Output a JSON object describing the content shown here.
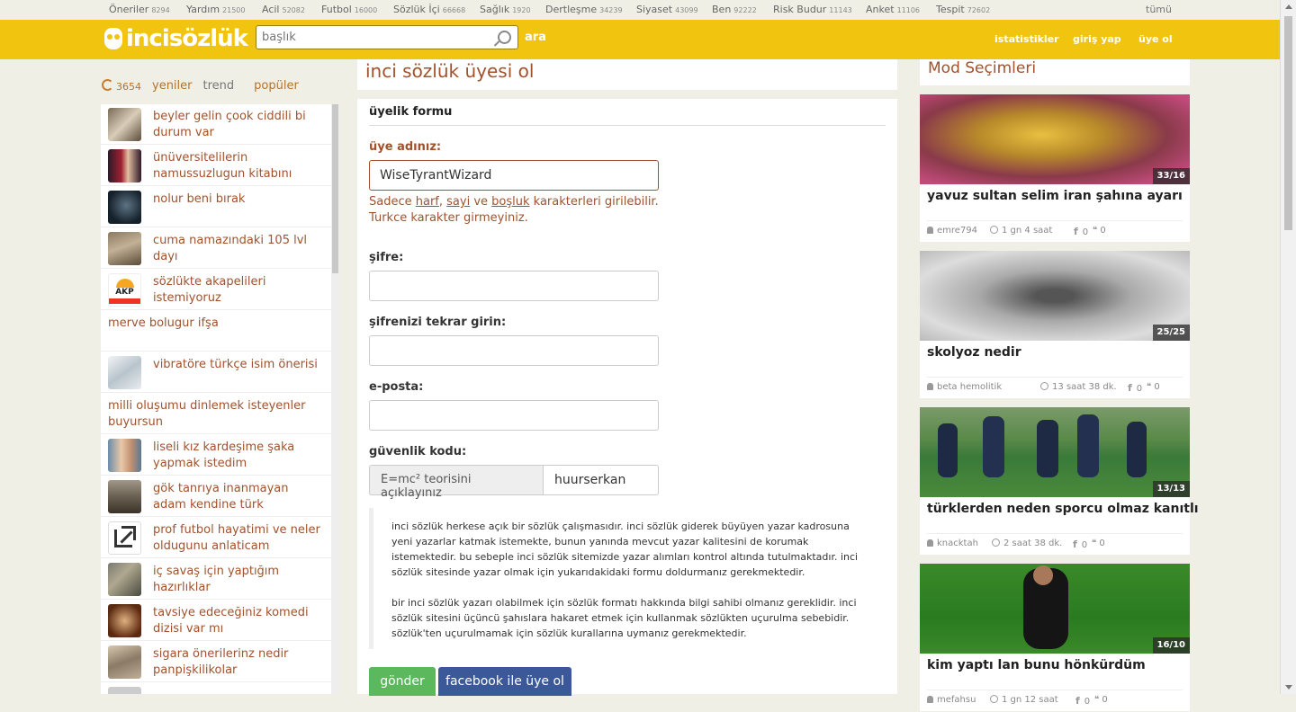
{
  "topnav": {
    "categories": [
      {
        "label": "Öneriler",
        "count": "8294"
      },
      {
        "label": "Yardım",
        "count": "21500"
      },
      {
        "label": "Acil",
        "count": "52082"
      },
      {
        "label": "Futbol",
        "count": "16000"
      },
      {
        "label": "Sözlük İçi",
        "count": "66668"
      },
      {
        "label": "Sağlık",
        "count": "1920"
      },
      {
        "label": "Dertleşme",
        "count": "34239"
      },
      {
        "label": "Siyaset",
        "count": "43099"
      },
      {
        "label": "Ben",
        "count": "92222"
      },
      {
        "label": "Risk Budur",
        "count": "11143"
      },
      {
        "label": "Anket",
        "count": "11106"
      },
      {
        "label": "Tespit",
        "count": "72602"
      }
    ],
    "all_label": "tümü"
  },
  "header": {
    "logo_text": "incisözlük",
    "search_placeholder": "başlık",
    "search_button": "ara",
    "links": [
      "istatistikler",
      "giriş yap",
      "üye ol"
    ],
    "accent": "#f1c40f"
  },
  "left": {
    "count": "3654",
    "tabs": [
      "yeniler",
      "trend",
      "popüler"
    ],
    "items": [
      {
        "text": "beyler gelin çook ciddili bi durum var",
        "thumb": true
      },
      {
        "text": "ünüversitelilerin namussuzlugun kitabını",
        "thumb": true
      },
      {
        "text": "nolur beni bırak",
        "thumb": true
      },
      {
        "text": "cuma namazındaki 105 lvl dayı",
        "thumb": true
      },
      {
        "text": "sözlükte akapelileri istemiyoruz",
        "thumb": true,
        "thumb_label": "AKP"
      },
      {
        "text": "merve bolugur ifşa",
        "thumb": false
      },
      {
        "text": "vibratöre türkçe isim önerisi",
        "thumb": true
      },
      {
        "text": "milli oluşumu dinlemek isteyenler buyursun",
        "thumb": false
      },
      {
        "text": "liseli kız kardeşime şaka yapmak istedim",
        "thumb": true
      },
      {
        "text": "gök tanrıya inanmayan adam kendine türk",
        "thumb": true
      },
      {
        "text": "prof futbol hayatimi ve neler oldugunu anlaticam",
        "thumb": true,
        "icon": "external-link-icon"
      },
      {
        "text": "iç savaş için yaptığım hazırlıklar",
        "thumb": true
      },
      {
        "text": "tavsiye edeceğiniz komedi dizisi var mı",
        "thumb": true
      },
      {
        "text": "sigara önerilerinz nedir panpişkilikolar",
        "thumb": true
      },
      {
        "text": "",
        "thumb": true
      }
    ]
  },
  "main": {
    "title": "inci sözlük üyesi ol",
    "form_header": "üyelik formu",
    "username_label": "üye adınız:",
    "username_value": "WiseTyrantWizard",
    "hint_pre": "Sadece ",
    "hint_w1": "harf",
    "hint_s1": ", ",
    "hint_w2": "sayi",
    "hint_s2": " ve ",
    "hint_w3": "boşluk",
    "hint_post": " karakterleri girilebilir.",
    "hint_line2": "Turkce karakter girmeyiniz.",
    "password_label": "şifre:",
    "password_repeat_label": "şifrenizi tekrar girin:",
    "email_label": "e-posta:",
    "captcha_label": "güvenlik kodu:",
    "captcha_question": "E=mc² teorisini açıklayınız",
    "captcha_answer": "huurserkan",
    "info_p1": "inci sözlük herkese açık bir sözlük çalışmasıdır. inci sözlük giderek büyüyen yazar kadrosuna yeni yazarlar katmak istemekte, bunun yanında mevcut yazar kalitesini de korumak istemektedir. bu sebeple inci sözlük sitemizde yazar alımları kontrol altında tutulmaktadır. inci sözlük sitesinde yazar olmak için yukarıdakidaki formu doldurmanız gerekmektedir.",
    "info_p2": "bir inci sözlük yazarı olabilmek için sözlük formatı hakkında bilgi sahibi olmanız gereklidir. inci sözlük sitesini üçüncü şahıslara hakaret etmek için kullanmak sözlükten uçurulma sebebidir. sözlük'ten uçurulmamak için sözlük kurallarına uymanız gerekmektedir.",
    "submit": "gönder",
    "facebook": "facebook ile üye ol"
  },
  "right": {
    "title": "Mod Seçimleri",
    "cards": [
      {
        "badge": "33/16",
        "title": "yavuz sultan selim iran şahına ayarı",
        "user": "emre794",
        "time": "1 gn 4 saat",
        "fb": "0",
        "tw": "0"
      },
      {
        "badge": "25/25",
        "title": "skolyoz nedir",
        "user": "beta hemolitik",
        "time": "13 saat 38 dk.",
        "fb": "0",
        "tw": "0"
      },
      {
        "badge": "13/13",
        "title": "türklerden neden sporcu olmaz kanıtlı",
        "user": "knacktah",
        "time": "2 saat 38 dk.",
        "fb": "0",
        "tw": "0"
      },
      {
        "badge": "16/10",
        "title": "kim yaptı lan bunu hönkürdüm",
        "user": "mefahsu",
        "time": "1 gn 12 saat",
        "fb": "0",
        "tw": "0"
      }
    ]
  }
}
